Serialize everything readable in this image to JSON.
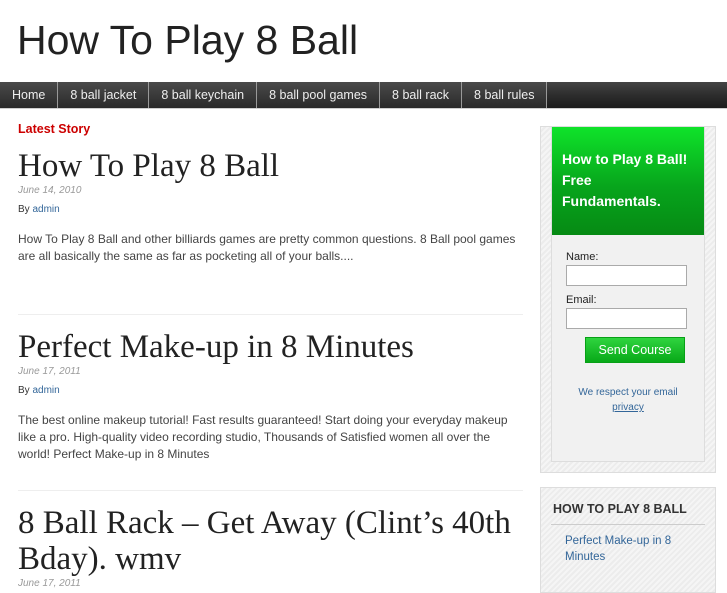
{
  "site": {
    "title": "How To Play 8 Ball"
  },
  "nav": {
    "items": [
      {
        "label": "Home"
      },
      {
        "label": "8 ball jacket"
      },
      {
        "label": "8 ball keychain"
      },
      {
        "label": "8 ball pool games"
      },
      {
        "label": "8 ball rack"
      },
      {
        "label": "8 ball rules"
      }
    ]
  },
  "main": {
    "section_label": "Latest Story",
    "posts": [
      {
        "title": "How To Play 8 Ball",
        "date": "June 14, 2010",
        "by_prefix": "By",
        "author": "admin",
        "excerpt": "How To Play 8 Ball and other billiards games are pretty common questions. 8 Ball pool games are all basically the same as far as pocketing all of your balls...."
      },
      {
        "title": "Perfect Make-up in 8 Minutes",
        "date": "June 17, 2011",
        "by_prefix": "By",
        "author": "admin",
        "excerpt": "The best online makeup tutorial! Fast results guaranteed! Start doing your everyday makeup like a pro. High-quality video recording studio, Thousands of Satisfied women all over the world! Perfect Make-up in 8 Minutes"
      },
      {
        "title": "8 Ball Rack – Get Away (Clint’s 40th Bday). wmv",
        "date": "June 17, 2011"
      }
    ]
  },
  "sidebar": {
    "optin": {
      "headline": "How to Play 8 Ball! Free Fundamentals.",
      "name_label": "Name:",
      "name_value": "",
      "email_label": "Email:",
      "email_value": "",
      "button_label": "Send Course",
      "privacy_text": "We respect your email",
      "privacy_link": "privacy"
    },
    "widget": {
      "title": "HOW TO PLAY 8 BALL",
      "links": [
        {
          "label": "Perfect Make-up in 8 Minutes"
        }
      ]
    }
  },
  "colors": {
    "accent_red": "#cc0000",
    "link_blue": "#336699",
    "optin_green": "#07a51c",
    "nav_dark": "#2d2d2d"
  }
}
